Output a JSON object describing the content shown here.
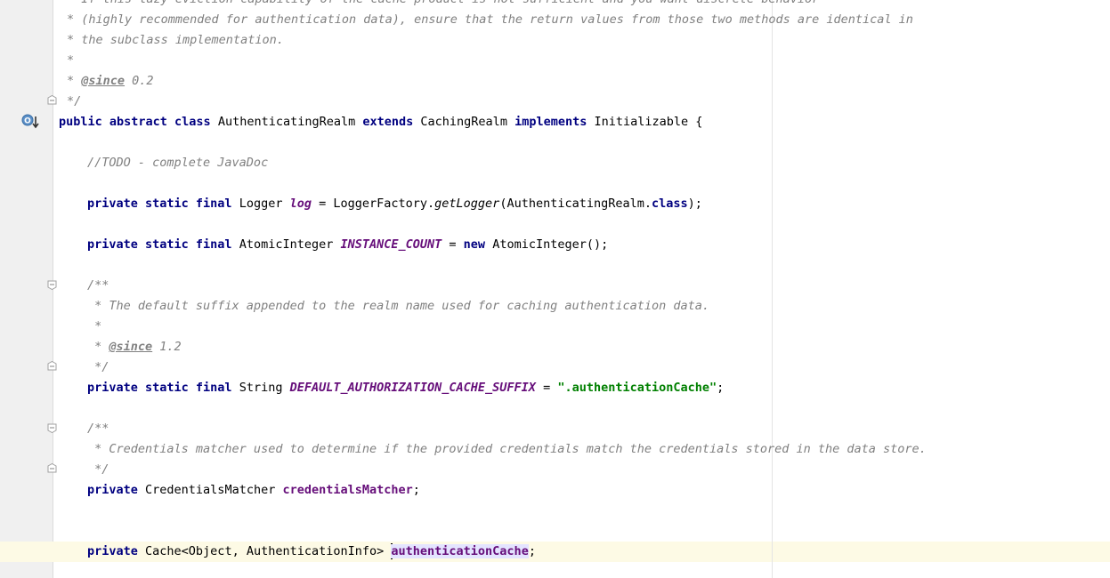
{
  "editor": {
    "code": {
      "c1": "* If this lazy eviction capability of the cache product is not sufficient and you want discrete behavior",
      "c2": "* (highly recommended for authentication data), ensure that the return values from those two methods are identical in",
      "c3": "* the subclass implementation.",
      "c4": "*",
      "c5_star": "* ",
      "c5_tag": "@since",
      "c5_ver": " 0.2",
      "c6": "*/",
      "cls": {
        "kw1": "public abstract class",
        "name": " AuthenticatingRealm ",
        "kw2": "extends",
        "parent": " CachingRealm ",
        "kw3": "implements",
        "iface": " Initializable {"
      },
      "todo": "//TODO - complete JavaDoc",
      "log": {
        "mods": "private static final",
        "type": " Logger ",
        "name": "log",
        "eq": " = LoggerFactory.",
        "method": "getLogger",
        "arg": "(AuthenticatingRealm.",
        "cls_kw": "class",
        "end": ");"
      },
      "count": {
        "mods": "private static final",
        "type": " AtomicInteger ",
        "name": "INSTANCE_COUNT",
        "eq": " = ",
        "new_kw": "new",
        "ctor": " AtomicInteger();"
      },
      "d1": "/**",
      "d2": " * The default suffix appended to the realm name used for caching authentication data.",
      "d3": " *",
      "d4_star": " * ",
      "d4_tag": "@since",
      "d4_ver": " 1.2",
      "d5": " */",
      "suffix": {
        "mods": "private static final",
        "type": " String ",
        "name": "DEFAULT_AUTHORIZATION_CACHE_SUFFIX",
        "eq": " = ",
        "value": "\".authenticationCache\"",
        "end": ";"
      },
      "e1": "/**",
      "e2": " * Credentials matcher used to determine if the provided credentials match the credentials stored in the data store.",
      "e3": " */",
      "matcher": {
        "mod": "private",
        "type": " CredentialsMatcher ",
        "name": "credentialsMatcher",
        "end": ";"
      },
      "cache": {
        "mod": "private",
        "type": " Cache<Object, AuthenticationInfo> ",
        "name": "authenticationCache",
        "end": ";"
      }
    },
    "icons": {
      "override": "overrides-up-icon",
      "fold": "fold-marker-icon"
    },
    "colors": {
      "keyword": "#000080",
      "comment": "#808080",
      "field": "#660e7a",
      "string": "#008000",
      "caret_row": "#fdfae5",
      "selection": "#e4e4ff"
    }
  }
}
